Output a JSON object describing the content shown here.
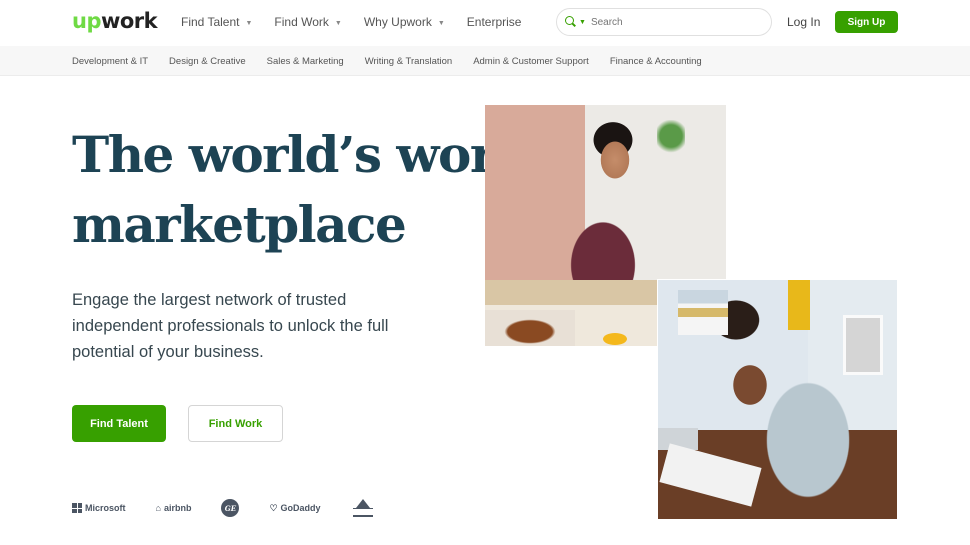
{
  "header": {
    "logo": {
      "up": "up",
      "work": "work"
    },
    "nav": [
      {
        "label": "Find Talent",
        "has_dropdown": true
      },
      {
        "label": "Find Work",
        "has_dropdown": true
      },
      {
        "label": "Why Upwork",
        "has_dropdown": true
      },
      {
        "label": "Enterprise",
        "has_dropdown": false
      }
    ],
    "search": {
      "placeholder": "Search",
      "icon": "search-icon"
    },
    "login_label": "Log In",
    "signup_label": "Sign Up"
  },
  "categories": [
    "Development & IT",
    "Design & Creative",
    "Sales & Marketing",
    "Writing & Translation",
    "Admin & Customer Support",
    "Finance & Accounting"
  ],
  "hero": {
    "title_line1": "The world’s work",
    "title_line2": "marketplace",
    "subtitle": "Engage the largest network of trusted independent professionals to unlock the full potential of your business.",
    "primary_button": "Find Talent",
    "secondary_button": "Find Work"
  },
  "trusted_by": {
    "microsoft": "Microsoft",
    "airbnb": "airbnb",
    "ge": "GE",
    "godaddy": "GoDaddy",
    "bissell": "bissell"
  },
  "colors": {
    "brand_green": "#37a000",
    "logo_green": "#6fda44",
    "title_navy": "#1d4354"
  }
}
